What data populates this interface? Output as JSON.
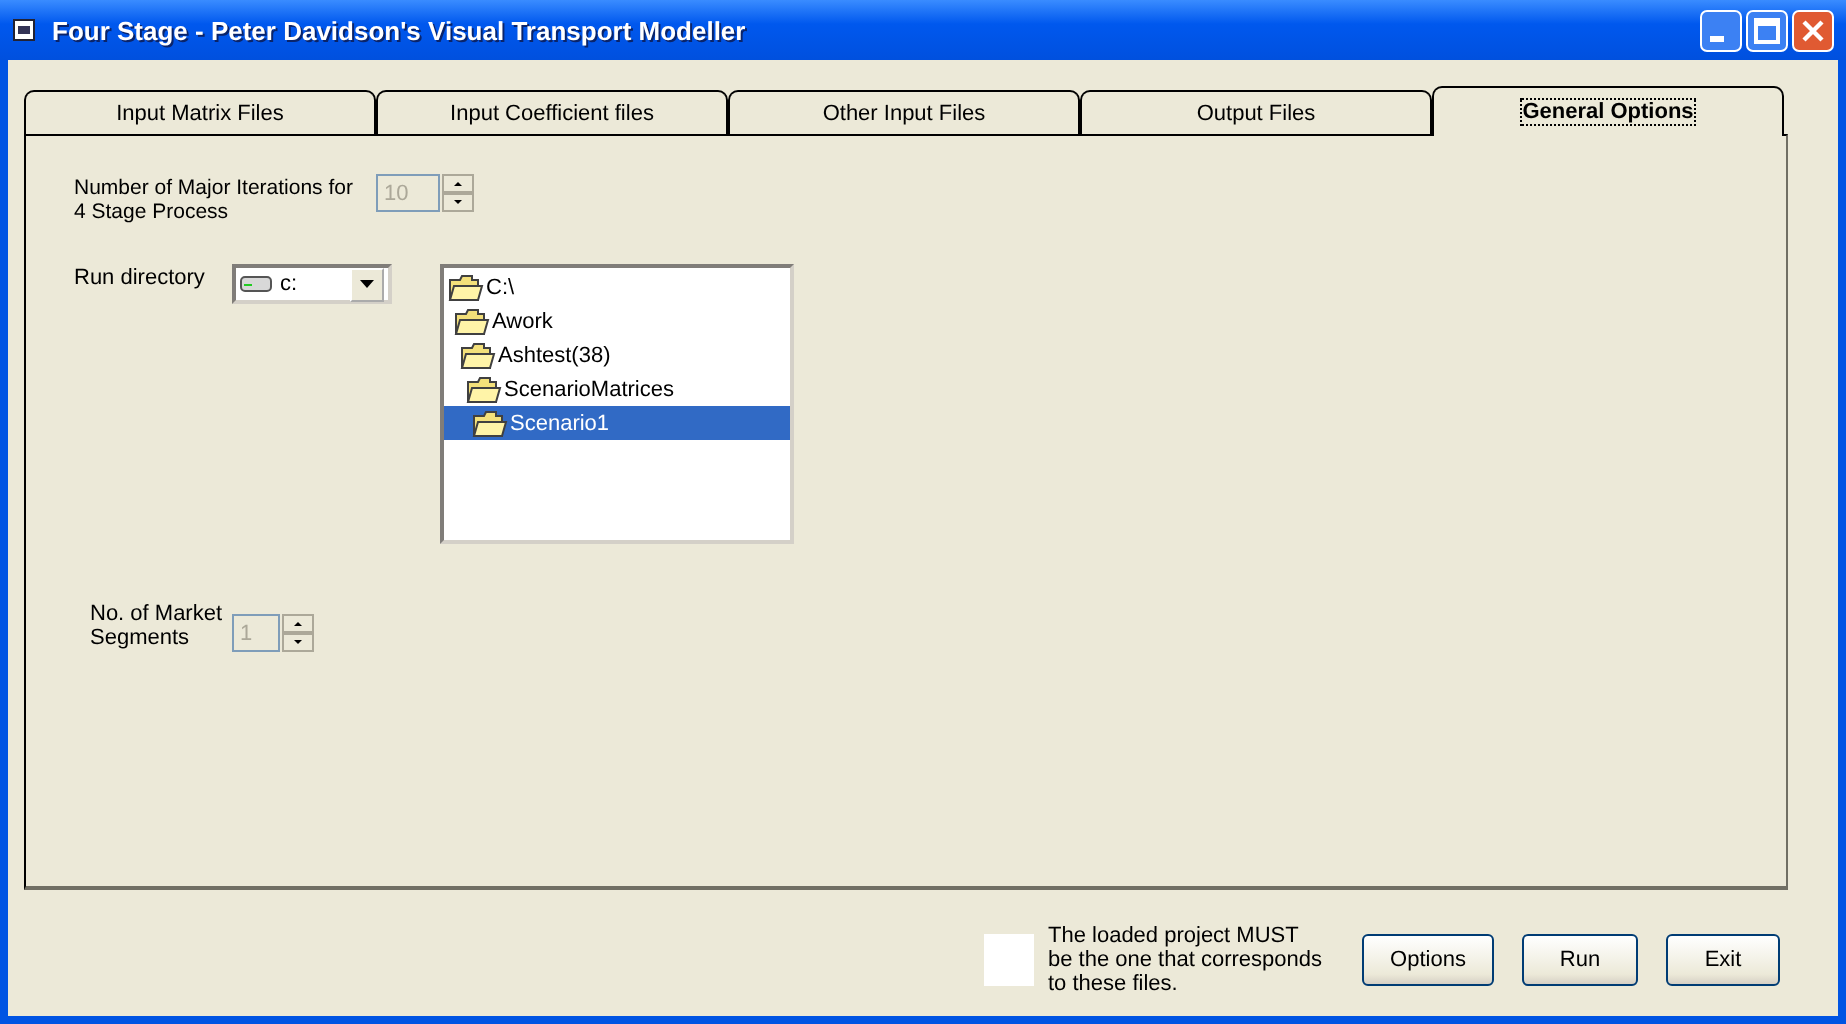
{
  "window": {
    "title": "Four Stage - Peter Davidson's Visual Transport Modeller"
  },
  "tabs": [
    {
      "label": "Input Matrix Files",
      "selected": false
    },
    {
      "label": "Input Coefficient files",
      "selected": false
    },
    {
      "label": "Other Input Files",
      "selected": false
    },
    {
      "label": "Output Files",
      "selected": false
    },
    {
      "label": "General Options",
      "selected": true
    }
  ],
  "iterations": {
    "label": "Number of Major Iterations for 4 Stage Process",
    "value": "10",
    "disabled": true
  },
  "run_directory": {
    "label": "Run directory",
    "drive": "c:",
    "tree": [
      {
        "name": "C:\\",
        "selected": false,
        "children": [
          {
            "name": "Awork",
            "selected": false,
            "children": [
              {
                "name": "Ashtest(38)",
                "selected": false,
                "children": [
                  {
                    "name": "ScenarioMatrices",
                    "selected": false,
                    "children": [
                      {
                        "name": "Scenario1",
                        "selected": true
                      }
                    ]
                  }
                ]
              }
            ]
          }
        ]
      }
    ]
  },
  "market_segments": {
    "label": "No. of Market Segments",
    "value": "1",
    "disabled": true
  },
  "status_note": "The loaded project MUST be the one that corresponds to these files.",
  "buttons": [
    {
      "label": "Options"
    },
    {
      "label": "Run"
    },
    {
      "label": "Exit"
    }
  ]
}
